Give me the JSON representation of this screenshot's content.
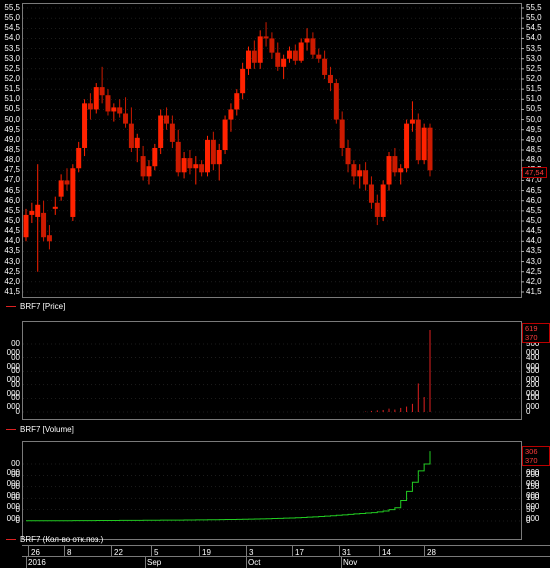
{
  "price_legend": "BRF7 [Price]",
  "volume_legend": "BRF7 [Volume]",
  "oi_legend": "BRF7 (Кол-во отк.поз.)",
  "price_tag": "47,54",
  "volume_tag": "619 370",
  "oi_tag": "306 370",
  "colors": {
    "up": "#ff2200",
    "down": "#cc1a00",
    "vol": "#e02020",
    "oi": "#22cc22",
    "grid": "#3a3a3a"
  },
  "price_ticks": [
    "55,5",
    "55,0",
    "54,5",
    "54,0",
    "53,5",
    "53,0",
    "52,5",
    "52,0",
    "51,5",
    "51,0",
    "50,5",
    "50,0",
    "49,5",
    "49,0",
    "48,5",
    "48,0",
    "47,5",
    "47,0",
    "46,5",
    "46,0",
    "45,5",
    "45,0",
    "44,5",
    "44,0",
    "43,5",
    "43,0",
    "42,5",
    "42,0",
    "41,5"
  ],
  "volume_ticks": [
    "500 000",
    "400 000",
    "300 000",
    "200 000",
    "100 000",
    "0"
  ],
  "volume_ticks_left": [
    "00 000",
    "00 000",
    "00 000",
    "00 000",
    "00 000",
    "0"
  ],
  "oi_ticks": [
    "250 000",
    "200 000",
    "150 000",
    "100 000",
    "50 000",
    "0"
  ],
  "oi_ticks_left": [
    "00 000",
    "00 000",
    "00 000",
    "00 000",
    "0 000",
    "0"
  ],
  "day_labels": [
    "26",
    "8",
    "22",
    "5",
    "19",
    "3",
    "17",
    "31",
    "14",
    "28"
  ],
  "month_labels": [
    "2016",
    "Sep",
    "Oct",
    "Nov"
  ],
  "chart_data": {
    "type": "candlestick",
    "ylim_price": [
      41.5,
      55.5
    ],
    "ylim_volume": [
      0,
      619370
    ],
    "ylim_oi": [
      0,
      306370
    ],
    "candles": [
      {
        "o": 44.2,
        "h": 45.6,
        "l": 44.0,
        "c": 45.3
      },
      {
        "o": 45.3,
        "h": 45.9,
        "l": 44.9,
        "c": 45.5
      },
      {
        "o": 45.2,
        "h": 47.8,
        "l": 42.5,
        "c": 45.8
      },
      {
        "o": 45.4,
        "h": 46.0,
        "l": 44.0,
        "c": 44.2
      },
      {
        "o": 44.3,
        "h": 44.8,
        "l": 43.6,
        "c": 44.0
      },
      {
        "o": 45.6,
        "h": 46.2,
        "l": 45.3,
        "c": 45.7
      },
      {
        "o": 46.2,
        "h": 47.3,
        "l": 46.0,
        "c": 47.0
      },
      {
        "o": 47.0,
        "h": 47.6,
        "l": 46.5,
        "c": 46.8
      },
      {
        "o": 45.2,
        "h": 47.8,
        "l": 45.0,
        "c": 47.6
      },
      {
        "o": 47.6,
        "h": 48.9,
        "l": 47.4,
        "c": 48.6
      },
      {
        "o": 48.6,
        "h": 51.0,
        "l": 48.2,
        "c": 50.8
      },
      {
        "o": 50.8,
        "h": 51.3,
        "l": 50.0,
        "c": 50.5
      },
      {
        "o": 50.5,
        "h": 51.8,
        "l": 50.3,
        "c": 51.6
      },
      {
        "o": 51.6,
        "h": 52.6,
        "l": 50.8,
        "c": 51.2
      },
      {
        "o": 51.2,
        "h": 51.5,
        "l": 50.2,
        "c": 50.4
      },
      {
        "o": 50.4,
        "h": 50.8,
        "l": 49.9,
        "c": 50.6
      },
      {
        "o": 50.6,
        "h": 51.0,
        "l": 50.1,
        "c": 50.3
      },
      {
        "o": 50.3,
        "h": 51.1,
        "l": 49.6,
        "c": 49.8
      },
      {
        "o": 49.8,
        "h": 50.6,
        "l": 48.4,
        "c": 48.6
      },
      {
        "o": 48.6,
        "h": 49.3,
        "l": 47.9,
        "c": 49.1
      },
      {
        "o": 48.2,
        "h": 48.7,
        "l": 47.0,
        "c": 47.2
      },
      {
        "o": 47.2,
        "h": 48.0,
        "l": 46.8,
        "c": 47.7
      },
      {
        "o": 47.7,
        "h": 48.8,
        "l": 47.5,
        "c": 48.6
      },
      {
        "o": 48.6,
        "h": 50.5,
        "l": 48.3,
        "c": 50.2
      },
      {
        "o": 50.2,
        "h": 50.6,
        "l": 49.5,
        "c": 49.8
      },
      {
        "o": 49.8,
        "h": 50.2,
        "l": 48.6,
        "c": 48.9
      },
      {
        "o": 48.9,
        "h": 49.5,
        "l": 47.2,
        "c": 47.4
      },
      {
        "o": 47.4,
        "h": 48.4,
        "l": 47.1,
        "c": 48.1
      },
      {
        "o": 48.1,
        "h": 48.5,
        "l": 47.3,
        "c": 47.6
      },
      {
        "o": 47.6,
        "h": 48.2,
        "l": 46.8,
        "c": 47.8
      },
      {
        "o": 47.8,
        "h": 48.0,
        "l": 47.2,
        "c": 47.4
      },
      {
        "o": 47.4,
        "h": 49.2,
        "l": 47.2,
        "c": 49.0
      },
      {
        "o": 49.0,
        "h": 49.4,
        "l": 47.5,
        "c": 47.8
      },
      {
        "o": 47.8,
        "h": 48.8,
        "l": 47.0,
        "c": 48.5
      },
      {
        "o": 48.5,
        "h": 50.2,
        "l": 48.3,
        "c": 50.0
      },
      {
        "o": 50.0,
        "h": 50.8,
        "l": 49.4,
        "c": 50.5
      },
      {
        "o": 50.5,
        "h": 51.5,
        "l": 50.2,
        "c": 51.3
      },
      {
        "o": 51.3,
        "h": 52.8,
        "l": 51.0,
        "c": 52.5
      },
      {
        "o": 52.5,
        "h": 53.6,
        "l": 52.2,
        "c": 53.4
      },
      {
        "o": 53.4,
        "h": 53.9,
        "l": 52.5,
        "c": 52.8
      },
      {
        "o": 52.8,
        "h": 54.4,
        "l": 52.5,
        "c": 54.1
      },
      {
        "o": 54.1,
        "h": 54.8,
        "l": 53.6,
        "c": 54.0
      },
      {
        "o": 54.0,
        "h": 54.3,
        "l": 53.0,
        "c": 53.3
      },
      {
        "o": 53.3,
        "h": 53.8,
        "l": 52.4,
        "c": 52.6
      },
      {
        "o": 52.6,
        "h": 53.2,
        "l": 52.0,
        "c": 53.0
      },
      {
        "o": 53.0,
        "h": 53.6,
        "l": 52.8,
        "c": 53.4
      },
      {
        "o": 53.4,
        "h": 53.7,
        "l": 52.7,
        "c": 52.9
      },
      {
        "o": 52.9,
        "h": 54.0,
        "l": 52.8,
        "c": 53.8
      },
      {
        "o": 53.8,
        "h": 54.5,
        "l": 53.4,
        "c": 54.0
      },
      {
        "o": 54.0,
        "h": 54.3,
        "l": 53.0,
        "c": 53.2
      },
      {
        "o": 53.2,
        "h": 53.5,
        "l": 52.8,
        "c": 53.0
      },
      {
        "o": 53.0,
        "h": 53.4,
        "l": 52.0,
        "c": 52.2
      },
      {
        "o": 52.2,
        "h": 52.6,
        "l": 51.4,
        "c": 51.8
      },
      {
        "o": 51.8,
        "h": 52.0,
        "l": 49.8,
        "c": 50.0
      },
      {
        "o": 50.0,
        "h": 50.4,
        "l": 48.2,
        "c": 48.6
      },
      {
        "o": 48.6,
        "h": 49.0,
        "l": 47.4,
        "c": 47.8
      },
      {
        "o": 47.8,
        "h": 48.0,
        "l": 46.8,
        "c": 47.2
      },
      {
        "o": 47.2,
        "h": 47.8,
        "l": 46.6,
        "c": 47.5
      },
      {
        "o": 47.5,
        "h": 47.9,
        "l": 46.5,
        "c": 46.8
      },
      {
        "o": 46.8,
        "h": 47.2,
        "l": 45.6,
        "c": 45.9
      },
      {
        "o": 45.9,
        "h": 46.3,
        "l": 44.8,
        "c": 45.2
      },
      {
        "o": 45.2,
        "h": 47.0,
        "l": 45.0,
        "c": 46.8
      },
      {
        "o": 46.8,
        "h": 48.4,
        "l": 46.5,
        "c": 48.2
      },
      {
        "o": 48.2,
        "h": 48.6,
        "l": 47.2,
        "c": 47.4
      },
      {
        "o": 47.4,
        "h": 47.8,
        "l": 46.8,
        "c": 47.6
      },
      {
        "o": 47.6,
        "h": 50.0,
        "l": 47.4,
        "c": 49.8
      },
      {
        "o": 49.8,
        "h": 50.9,
        "l": 49.4,
        "c": 50.0
      },
      {
        "o": 50.0,
        "h": 50.3,
        "l": 47.8,
        "c": 48.0
      },
      {
        "o": 48.0,
        "h": 49.8,
        "l": 47.8,
        "c": 49.6
      },
      {
        "o": 49.6,
        "h": 49.8,
        "l": 47.2,
        "c": 47.5
      }
    ],
    "volume": [
      0,
      0,
      0,
      0,
      0,
      0,
      0,
      0,
      0,
      0,
      0,
      0,
      0,
      0,
      0,
      0,
      0,
      0,
      0,
      0,
      0,
      0,
      0,
      0,
      0,
      0,
      0,
      0,
      0,
      0,
      0,
      0,
      0,
      0,
      0,
      0,
      0,
      0,
      0,
      0,
      0,
      0,
      0,
      0,
      0,
      0,
      0,
      0,
      0,
      0,
      0,
      0,
      0,
      0,
      0,
      0,
      0,
      0,
      3000,
      8000,
      12000,
      15000,
      25000,
      18000,
      30000,
      40000,
      60000,
      210000,
      110000,
      619370
    ],
    "oi": [
      1000,
      1000,
      1000,
      1000,
      1200,
      1200,
      1300,
      1300,
      1500,
      1500,
      1700,
      1800,
      2000,
      2100,
      2200,
      2400,
      2500,
      2700,
      2800,
      3000,
      3100,
      3200,
      3400,
      3600,
      3700,
      3900,
      4100,
      4300,
      4500,
      4800,
      5100,
      5400,
      5700,
      6000,
      6400,
      6800,
      7200,
      7700,
      8200,
      8800,
      9400,
      10000,
      10800,
      11500,
      12400,
      13400,
      14400,
      15500,
      16800,
      18200,
      19700,
      21300,
      23000,
      25000,
      27000,
      29000,
      31000,
      33000,
      35000,
      37000,
      40000,
      44000,
      50000,
      58000,
      90000,
      130000,
      170000,
      220000,
      250000,
      306370
    ]
  }
}
